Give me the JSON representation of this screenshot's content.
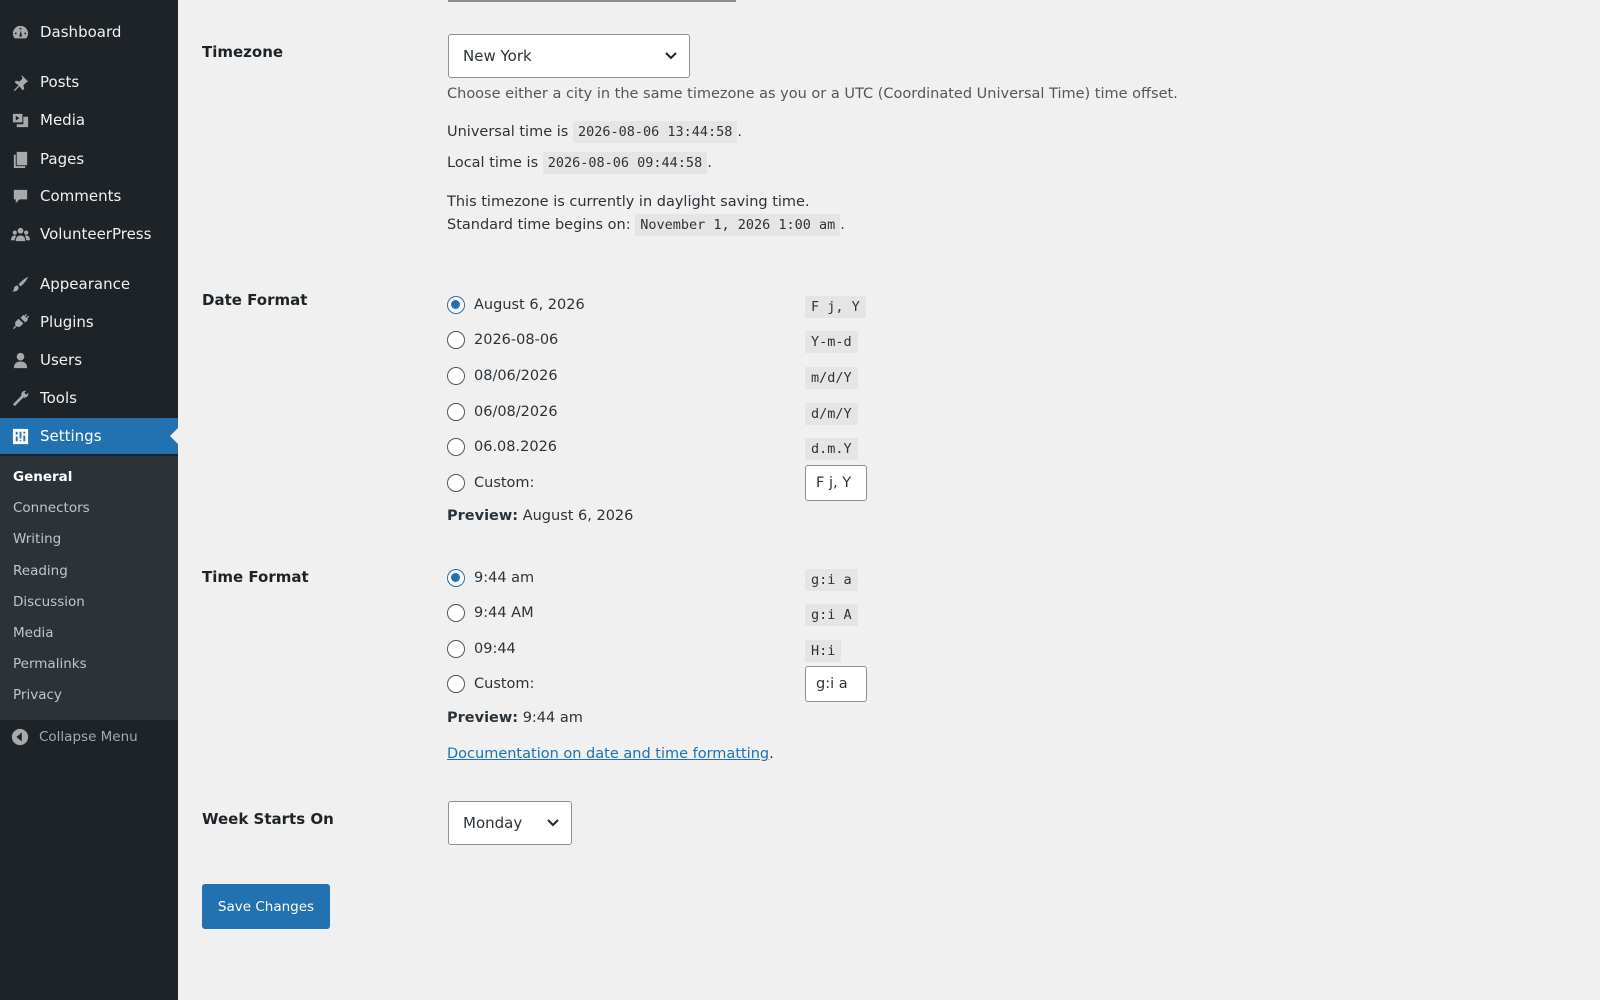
{
  "sidebar": {
    "items": [
      {
        "label": "Dashboard",
        "icon": "dashboard-icon"
      },
      {
        "label": "Posts",
        "icon": "pin-icon"
      },
      {
        "label": "Media",
        "icon": "media-icon"
      },
      {
        "label": "Pages",
        "icon": "pages-icon"
      },
      {
        "label": "Comments",
        "icon": "comment-icon"
      },
      {
        "label": "VolunteerPress",
        "icon": "group-icon"
      },
      {
        "label": "Appearance",
        "icon": "brush-icon"
      },
      {
        "label": "Plugins",
        "icon": "plugin-icon"
      },
      {
        "label": "Users",
        "icon": "user-icon"
      },
      {
        "label": "Tools",
        "icon": "wrench-icon"
      },
      {
        "label": "Settings",
        "icon": "settings-icon"
      }
    ],
    "submenu": [
      "General",
      "Connectors",
      "Writing",
      "Reading",
      "Discussion",
      "Media",
      "Permalinks",
      "Privacy"
    ],
    "collapse_label": "Collapse Menu"
  },
  "timezone": {
    "label": "Timezone",
    "selected": "New York",
    "description": "Choose either a city in the same timezone as you or a UTC (Coordinated Universal Time) time offset.",
    "universal_prefix": "Universal time is",
    "universal_value": "2026-08-06 13:44:58",
    "local_prefix": "Local time is",
    "local_value": "2026-08-06 09:44:58",
    "dst_text": "This timezone is currently in daylight saving time.",
    "standard_prefix": "Standard time begins on:",
    "standard_value": "November 1, 2026 1:00 am"
  },
  "date_format": {
    "label": "Date Format",
    "options": [
      {
        "label": "August 6, 2026",
        "format": "F j, Y",
        "checked": true
      },
      {
        "label": "2026-08-06",
        "format": "Y-m-d",
        "checked": false
      },
      {
        "label": "08/06/2026",
        "format": "m/d/Y",
        "checked": false
      },
      {
        "label": "06/08/2026",
        "format": "d/m/Y",
        "checked": false
      },
      {
        "label": "06.08.2026",
        "format": "d.m.Y",
        "checked": false
      }
    ],
    "custom_label": "Custom:",
    "custom_value": "F j, Y",
    "preview_label": "Preview:",
    "preview_value": "August 6, 2026"
  },
  "time_format": {
    "label": "Time Format",
    "options": [
      {
        "label": "9:44 am",
        "format": "g:i a",
        "checked": true
      },
      {
        "label": "9:44 AM",
        "format": "g:i A",
        "checked": false
      },
      {
        "label": "09:44",
        "format": "H:i",
        "checked": false
      }
    ],
    "custom_label": "Custom:",
    "custom_value": "g:i a",
    "preview_label": "Preview:",
    "preview_value": "9:44 am",
    "doc_link": "Documentation on date and time formatting",
    "doc_suffix": "."
  },
  "week": {
    "label": "Week Starts On",
    "selected": "Monday"
  },
  "save_label": "Save Changes",
  "colors": {
    "accent": "#2271b1",
    "sidebar_bg": "#1d2327",
    "submenu_bg": "#2c3338",
    "page_bg": "#f0f0f1"
  }
}
